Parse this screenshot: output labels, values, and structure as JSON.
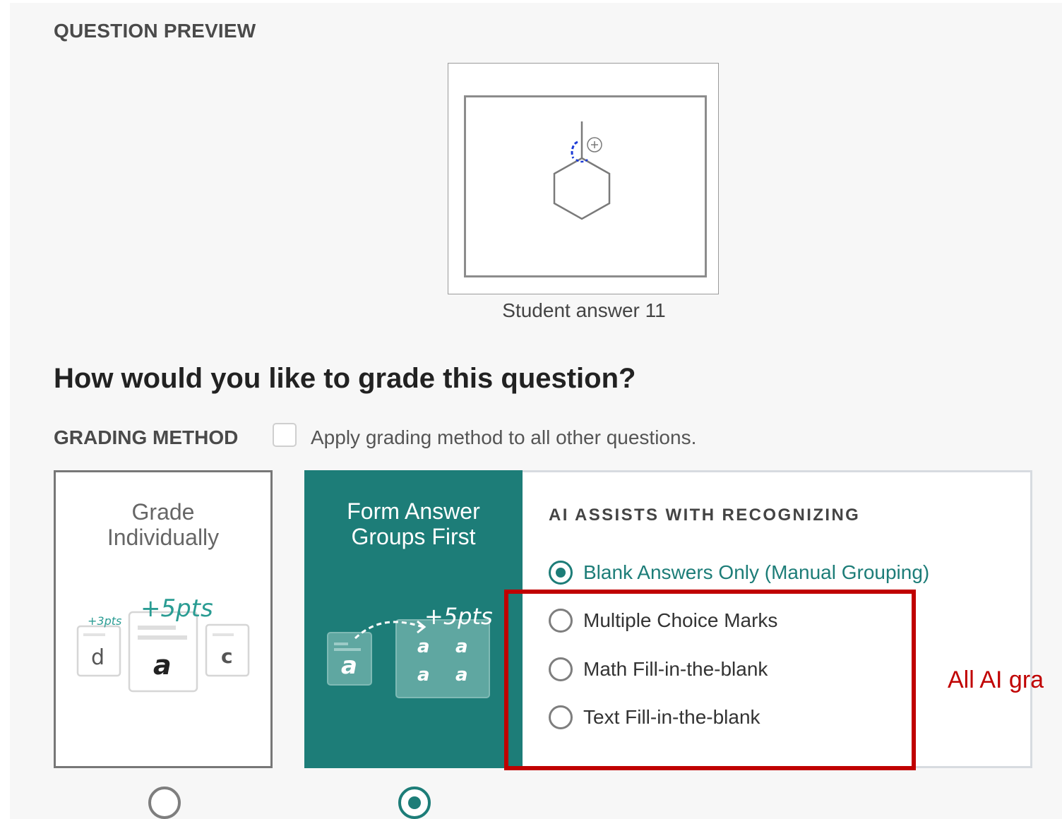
{
  "preview": {
    "section_label": "QUESTION PREVIEW",
    "caption": "Student answer 11",
    "image_icon": "hexagon-molecule-sketch"
  },
  "grading": {
    "heading": "How would you like to grade this question?",
    "method_label": "GRADING METHOD",
    "apply_all_label": "Apply grading method to all other questions.",
    "apply_all_checked": false
  },
  "cards": {
    "individual": {
      "title_line1": "Grade",
      "title_line2": "Individually",
      "illustration_pts_small": "+3pts",
      "illustration_pts_large": "+5pts",
      "illustration_letters": [
        "d",
        "a",
        "c"
      ],
      "selected": false
    },
    "groups": {
      "title_line1": "Form Answer",
      "title_line2": "Groups First",
      "illustration_pts": "+5pts",
      "illustration_letters": [
        "a",
        "a",
        "a",
        "a",
        "a"
      ],
      "selected": true
    }
  },
  "ai_assist": {
    "title": "AI ASSISTS WITH RECOGNIZING",
    "options": [
      {
        "label": "Blank Answers Only (Manual Grouping)",
        "selected": true
      },
      {
        "label": "Multiple Choice Marks",
        "selected": false
      },
      {
        "label": "Math Fill-in-the-blank",
        "selected": false
      },
      {
        "label": "Text Fill-in-the-blank",
        "selected": false
      }
    ]
  },
  "annotation": {
    "text": "All AI gra"
  },
  "colors": {
    "accent": "#1d7d78",
    "annotation": "#c00000",
    "panel_bg": "#f7f7f7"
  }
}
